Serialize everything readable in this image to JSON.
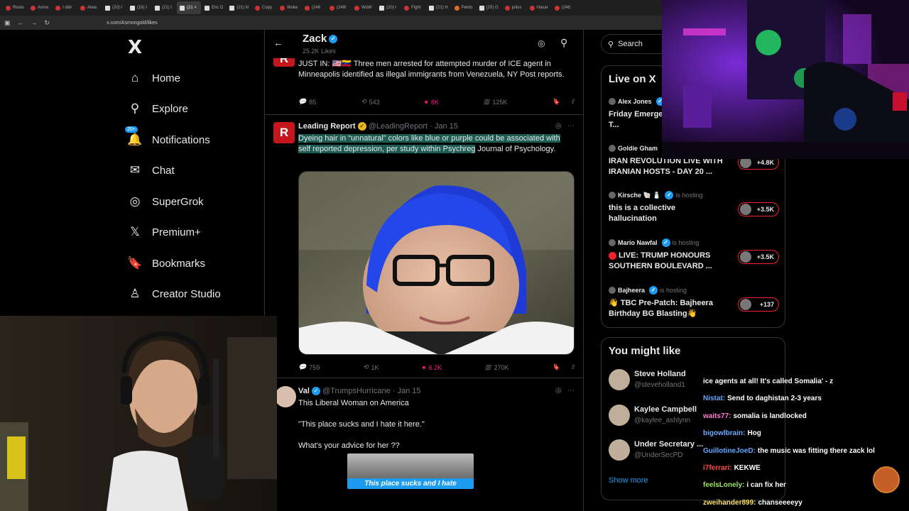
{
  "browser": {
    "tabs": [
      {
        "label": "Resto",
        "icon": "circle"
      },
      {
        "label": "Asmo",
        "icon": "circle"
      },
      {
        "label": "I didr",
        "icon": "circle"
      },
      {
        "label": "Alwa",
        "icon": "circle"
      },
      {
        "label": "(20) ł",
        "icon": "x"
      },
      {
        "label": "(16) ł",
        "icon": "x"
      },
      {
        "label": "(21) ł",
        "icon": "x"
      },
      {
        "label": "(21 ×",
        "icon": "x",
        "active": true
      },
      {
        "label": "Eric D",
        "icon": "x"
      },
      {
        "label": "(21) N",
        "icon": "x"
      },
      {
        "label": "Copy",
        "icon": "circle"
      },
      {
        "label": "Woke",
        "icon": "circle"
      },
      {
        "label": "(246",
        "icon": "circle"
      },
      {
        "label": "(246!",
        "icon": "circle"
      },
      {
        "label": "WoW",
        "icon": "circle"
      },
      {
        "label": "(20) ł",
        "icon": "x"
      },
      {
        "label": "Fight",
        "icon": "circle"
      },
      {
        "label": "(21) H",
        "icon": "x"
      },
      {
        "label": "Pento",
        "icon": "shield"
      },
      {
        "label": "(20) G",
        "icon": "x"
      },
      {
        "label": "julius",
        "icon": "circle"
      },
      {
        "label": "Hasar",
        "icon": "circle"
      },
      {
        "label": "(246:",
        "icon": "circle"
      }
    ],
    "url": "x.com/Asmongold/likes"
  },
  "nav": {
    "logo": "X",
    "items": [
      {
        "label": "Home",
        "icon": "home-icon",
        "glyph": "⌂"
      },
      {
        "label": "Explore",
        "icon": "search-icon",
        "glyph": "⚲"
      },
      {
        "label": "Notifications",
        "icon": "bell-icon",
        "glyph": "🔔",
        "badge": "20+"
      },
      {
        "label": "Chat",
        "icon": "mail-icon",
        "glyph": "✉"
      },
      {
        "label": "SuperGrok",
        "icon": "grok-icon",
        "glyph": "◎"
      },
      {
        "label": "Premium+",
        "icon": "x-logo-icon",
        "glyph": "𝕏"
      },
      {
        "label": "Bookmarks",
        "icon": "bookmark-icon",
        "glyph": "🔖"
      },
      {
        "label": "Creator Studio",
        "icon": "creator-icon",
        "glyph": "♙"
      }
    ]
  },
  "header": {
    "name": "Zack",
    "likes": "25.2K Likes"
  },
  "tweets": [
    {
      "text": "JUST IN: 🇺🇸🇻🇪 Three men arrested for attempted murder of ICE agent in Minneapolis identified as illegal immigrants from Venezuela, NY Post reports.",
      "replies": "85",
      "reposts": "543",
      "likes": "8K",
      "views": "125K"
    },
    {
      "name": "Leading Report",
      "handle": "@LeadingReport",
      "date": "· Jan 15",
      "text_hl": "Dyeing hair in “unnatural” colors like blue or purple could be associated with self reported depression, per study within Psychreg",
      "text_rest": " Journal of Psychology.",
      "replies": "759",
      "reposts": "1K",
      "likes": "6.2K",
      "views": "270K"
    },
    {
      "name": "Val",
      "handle": "@TrumpsHurricane",
      "date": "· Jan 15",
      "lines": [
        "This Liberal Woman on America",
        "\"This place sucks and I hate it here.\"",
        "What's your advice for her ??"
      ],
      "caption": "This place sucks and I hate"
    }
  ],
  "search": {
    "label": "Search"
  },
  "live": {
    "title": "Live on X",
    "items": [
      {
        "host": "Alex Jones",
        "hosting": "",
        "title": "Friday Emerge... EXCLUSIVE: T...",
        "count": ""
      },
      {
        "host": "Goldie Gham",
        "hosting": "",
        "title": "IRAN REVOLUTION LIVE WITH IRANIAN HOSTS - DAY 20 ...",
        "count": "+4.8K"
      },
      {
        "host": "Kirsche 🐚 🧂",
        "hosting": "is hosting",
        "title": "this is a collective hallucination",
        "count": "+3.5K"
      },
      {
        "host": "Mario Nawfal",
        "hosting": "is hosting",
        "title": "LIVE: TRUMP HONOURS SOUTHERN BOULEVARD ...",
        "count": "+3.5K",
        "dot": true
      },
      {
        "host": "Bajheera",
        "hosting": "is hosting",
        "title": "👋 TBC Pre-Patch: Bajheera Birthday BG Blasting👋",
        "count": "+137"
      }
    ]
  },
  "wtf": {
    "title": "You might like",
    "items": [
      {
        "name": "Steve Holland",
        "handle": "@steveholland1"
      },
      {
        "name": "Kaylee Campbell",
        "handle": "@kaylee_ashlynn"
      },
      {
        "name": "Under Secretary ...",
        "handle": "@UnderSecPD"
      }
    ],
    "show_more": "Show more"
  },
  "chat": [
    {
      "user": "",
      "color": "#ffffff",
      "msg": "ice agents at all! It's called Somalia' - z"
    },
    {
      "user": "Nistat:",
      "color": "#5fa8ff",
      "msg": "Send to daghistan 2-3 years"
    },
    {
      "user": "waits77:",
      "color": "#ff7ccf",
      "msg": "somalia is landlocked"
    },
    {
      "user": "bigowlbrain:",
      "color": "#6fa8ff",
      "msg": "Hog"
    },
    {
      "user": "GuillotineJoeD:",
      "color": "#5fa8ff",
      "msg": "the music was fitting there zack lol"
    },
    {
      "user": "i7ferrari:",
      "color": "#ff4c4c",
      "msg": "KEKWE"
    },
    {
      "user": "feelsLonely:",
      "color": "#9be564",
      "msg": "i can fix her"
    },
    {
      "user": "zweihander899:",
      "color": "#ffe46b",
      "msg": "chanseeeeyy"
    }
  ]
}
